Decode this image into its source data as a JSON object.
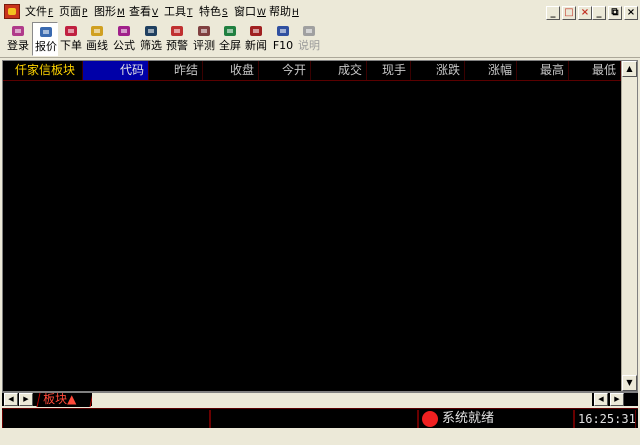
{
  "menu": [
    {
      "label": "文件",
      "key": "F"
    },
    {
      "label": "页面",
      "key": "P"
    },
    {
      "label": "图形",
      "key": "M"
    },
    {
      "label": "查看",
      "key": "V"
    },
    {
      "label": "工具",
      "key": "T"
    },
    {
      "label": "特色",
      "key": "S"
    },
    {
      "label": "窗口",
      "key": "W"
    },
    {
      "label": "帮助",
      "key": "H"
    }
  ],
  "toolbar": [
    {
      "label": "登录",
      "icon": "login-pencil-icon",
      "color": "#b03a8a"
    },
    {
      "label": "报价",
      "icon": "quote-chart-icon",
      "color": "#3a6ab0",
      "active": true
    },
    {
      "label": "下单",
      "icon": "order-t-icon",
      "color": "#c02040"
    },
    {
      "label": "画线",
      "icon": "draw-line-icon",
      "color": "#d0a020"
    },
    {
      "label": "公式",
      "icon": "formula-icon",
      "color": "#a0208a"
    },
    {
      "label": "筛选",
      "icon": "binoculars-icon",
      "color": "#204060"
    },
    {
      "label": "预警",
      "icon": "alert-icon",
      "color": "#c03030"
    },
    {
      "label": "评测",
      "icon": "evaluate-icon",
      "color": "#804040"
    },
    {
      "label": "全屏",
      "icon": "fullscreen-icon",
      "color": "#208040"
    },
    {
      "label": "新闻",
      "icon": "news-icon",
      "color": "#a02020"
    },
    {
      "label": "F10",
      "icon": "f10-books-icon",
      "color": "#3050a0"
    },
    {
      "label": "说明",
      "icon": "help-disabled-icon",
      "color": "#a0a0a0",
      "disabled": true
    }
  ],
  "table": {
    "columns": [
      "仟家信板块",
      "代码",
      "昨结",
      "收盘",
      "今开",
      "成交",
      "现手",
      "涨跌",
      "涨幅",
      "最高",
      "最低"
    ],
    "selected_index": 1
  },
  "sheet_tab": "板块▲",
  "status": {
    "text": "系统就绪",
    "time": "16:25:31",
    "indicator_color": "#f02020"
  },
  "window_controls": [
    "_",
    "□",
    "×",
    "_",
    "⧉",
    "×"
  ]
}
